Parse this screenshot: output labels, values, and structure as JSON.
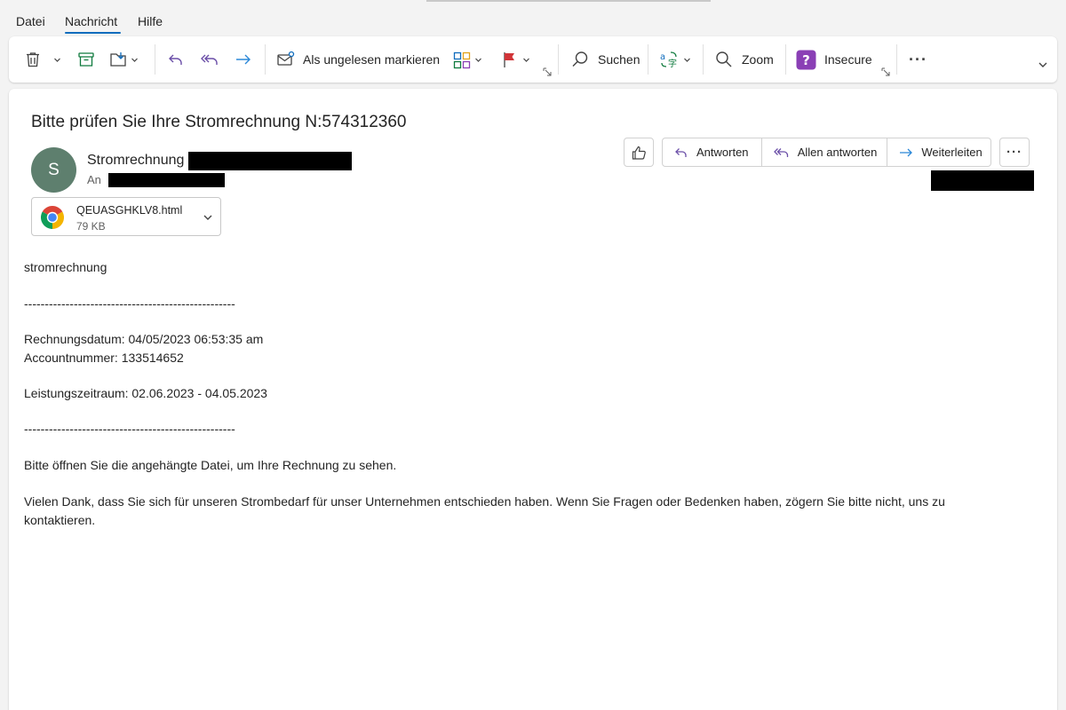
{
  "menu": {
    "items": [
      "Datei",
      "Nachricht",
      "Hilfe"
    ],
    "active": "Nachricht"
  },
  "ribbon": {
    "mark_unread_label": "Als ungelesen markieren",
    "search_label": "Suchen",
    "zoom_label": "Zoom",
    "insecure_label": "Insecure",
    "more_glyph": "···"
  },
  "message": {
    "subject": "Bitte prüfen Sie Ihre Stromrechnung N:574312360",
    "avatar_initial": "S",
    "sender_name": "Stromrechnung",
    "to_label": "An",
    "actions": {
      "reply": "Antworten",
      "reply_all": "Allen antworten",
      "forward": "Weiterleiten",
      "more_glyph": "···"
    },
    "attachment": {
      "name": "QEUASGHKLV8.html",
      "size": "79 KB"
    },
    "body": {
      "greeting": "stromrechnung",
      "divider": "---------------------------------------------------",
      "invoice_date": "Rechnungsdatum: 04/05/2023 06:53:35 am",
      "account_number": "Accountnummer: 133514652",
      "service_period": "Leistungszeitraum: 02.06.2023 - 04.05.2023",
      "instruction": "Bitte öffnen Sie die angehängte Datei, um Ihre Rechnung zu sehen.",
      "closing": "Vielen Dank, dass Sie sich für unseren Strombedarf für unser Unternehmen entschieden haben. Wenn Sie Fragen oder Bedenken haben, zögern Sie bitte nicht, uns zu kontaktieren."
    }
  },
  "colors": {
    "accent": "#0f6cbd",
    "reply_arrow": "#6b4fa8",
    "forward_arrow": "#2b88d8",
    "insecure_badge": "#8a3fb5",
    "avatar": "#5e7f6e"
  }
}
